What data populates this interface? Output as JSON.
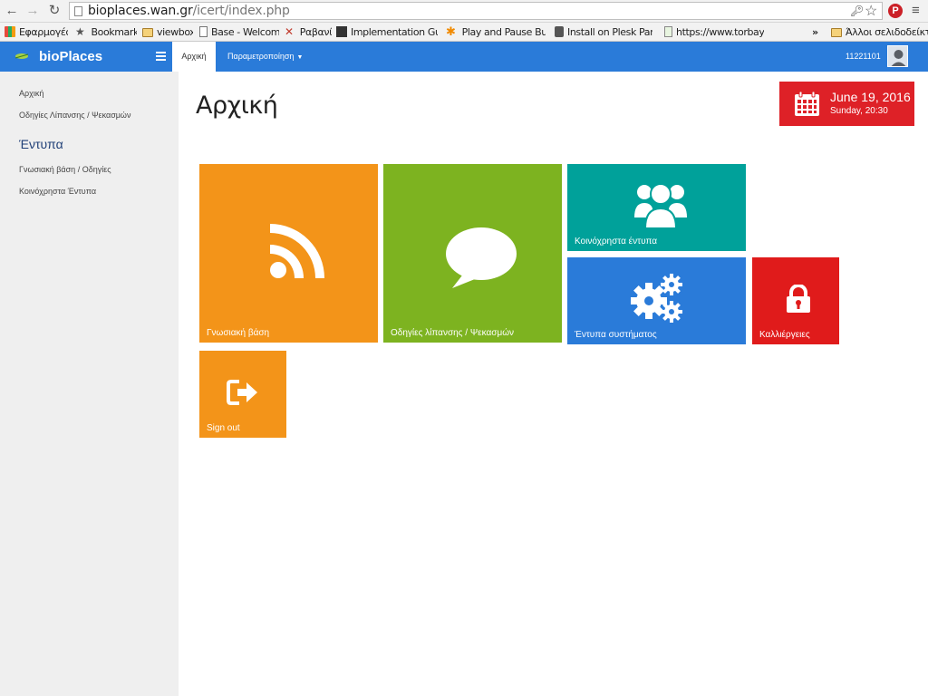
{
  "browser": {
    "url_host": "bioplaces.wan.gr",
    "url_path": "/icert/index.php",
    "bookmarks": [
      {
        "label": "Εφαρμογές",
        "icon": "apps-grid-icon"
      },
      {
        "label": "Bookmarks",
        "icon": "star-icon"
      },
      {
        "label": "viewbox",
        "icon": "folder-icon"
      },
      {
        "label": "Base - Welcome",
        "icon": "document-icon"
      },
      {
        "label": "Ραβανί",
        "icon": "tools-icon"
      },
      {
        "label": "Implementation Guide",
        "icon": "dark-page-icon"
      },
      {
        "label": "Play and Pause Button",
        "icon": "orange-asterisk-icon"
      },
      {
        "label": "Install on Plesk Panel",
        "icon": "plesk-icon"
      },
      {
        "label": "https://www.torbay.gov",
        "icon": "green-page-icon"
      }
    ],
    "more_bookmarks": "»",
    "other_bookmarks": "Άλλοι σελιδοδείκτες"
  },
  "app": {
    "brand": "bioPlaces",
    "nav": {
      "active": "Αρχική",
      "settings": "Παραμετροποίηση"
    },
    "user_id": "11221101"
  },
  "sidebar": {
    "link1": "Αρχική",
    "link2": "Οδηγίες Λίπανσης / Ψεκασμών",
    "heading": "Έντυπα",
    "link3": "Γνωσιακή βάση / Οδηγίες",
    "link4": "Κοινόχρηστα Έντυπα"
  },
  "main": {
    "title": "Αρχική",
    "date_main": "June 19, 2016",
    "date_sub": "Sunday, 20:30"
  },
  "tiles": {
    "knowledge": {
      "label": "Γνωσιακή βάση",
      "color": "#f39419",
      "icon": "rss-icon"
    },
    "instructions": {
      "label": "Οδηγίες λίπανσης / Ψεκασμών",
      "color": "#7db320",
      "icon": "speech-bubble-icon"
    },
    "shared": {
      "label": "Κοινόχρηστα έντυπα",
      "color": "#00a19a",
      "icon": "users-group-icon"
    },
    "system": {
      "label": "Έντυπα συστήματος",
      "color": "#2a7bd9",
      "icon": "gears-icon"
    },
    "crops": {
      "label": "Καλλιέργειες",
      "color": "#e01b1b",
      "icon": "lock-icon"
    },
    "signout": {
      "label": "Sign out",
      "color": "#f39419",
      "icon": "sign-out-icon"
    }
  },
  "colors": {
    "appbar": "#2a7bd9",
    "date_box": "#de2127",
    "sidebar_bg": "#efefef"
  }
}
